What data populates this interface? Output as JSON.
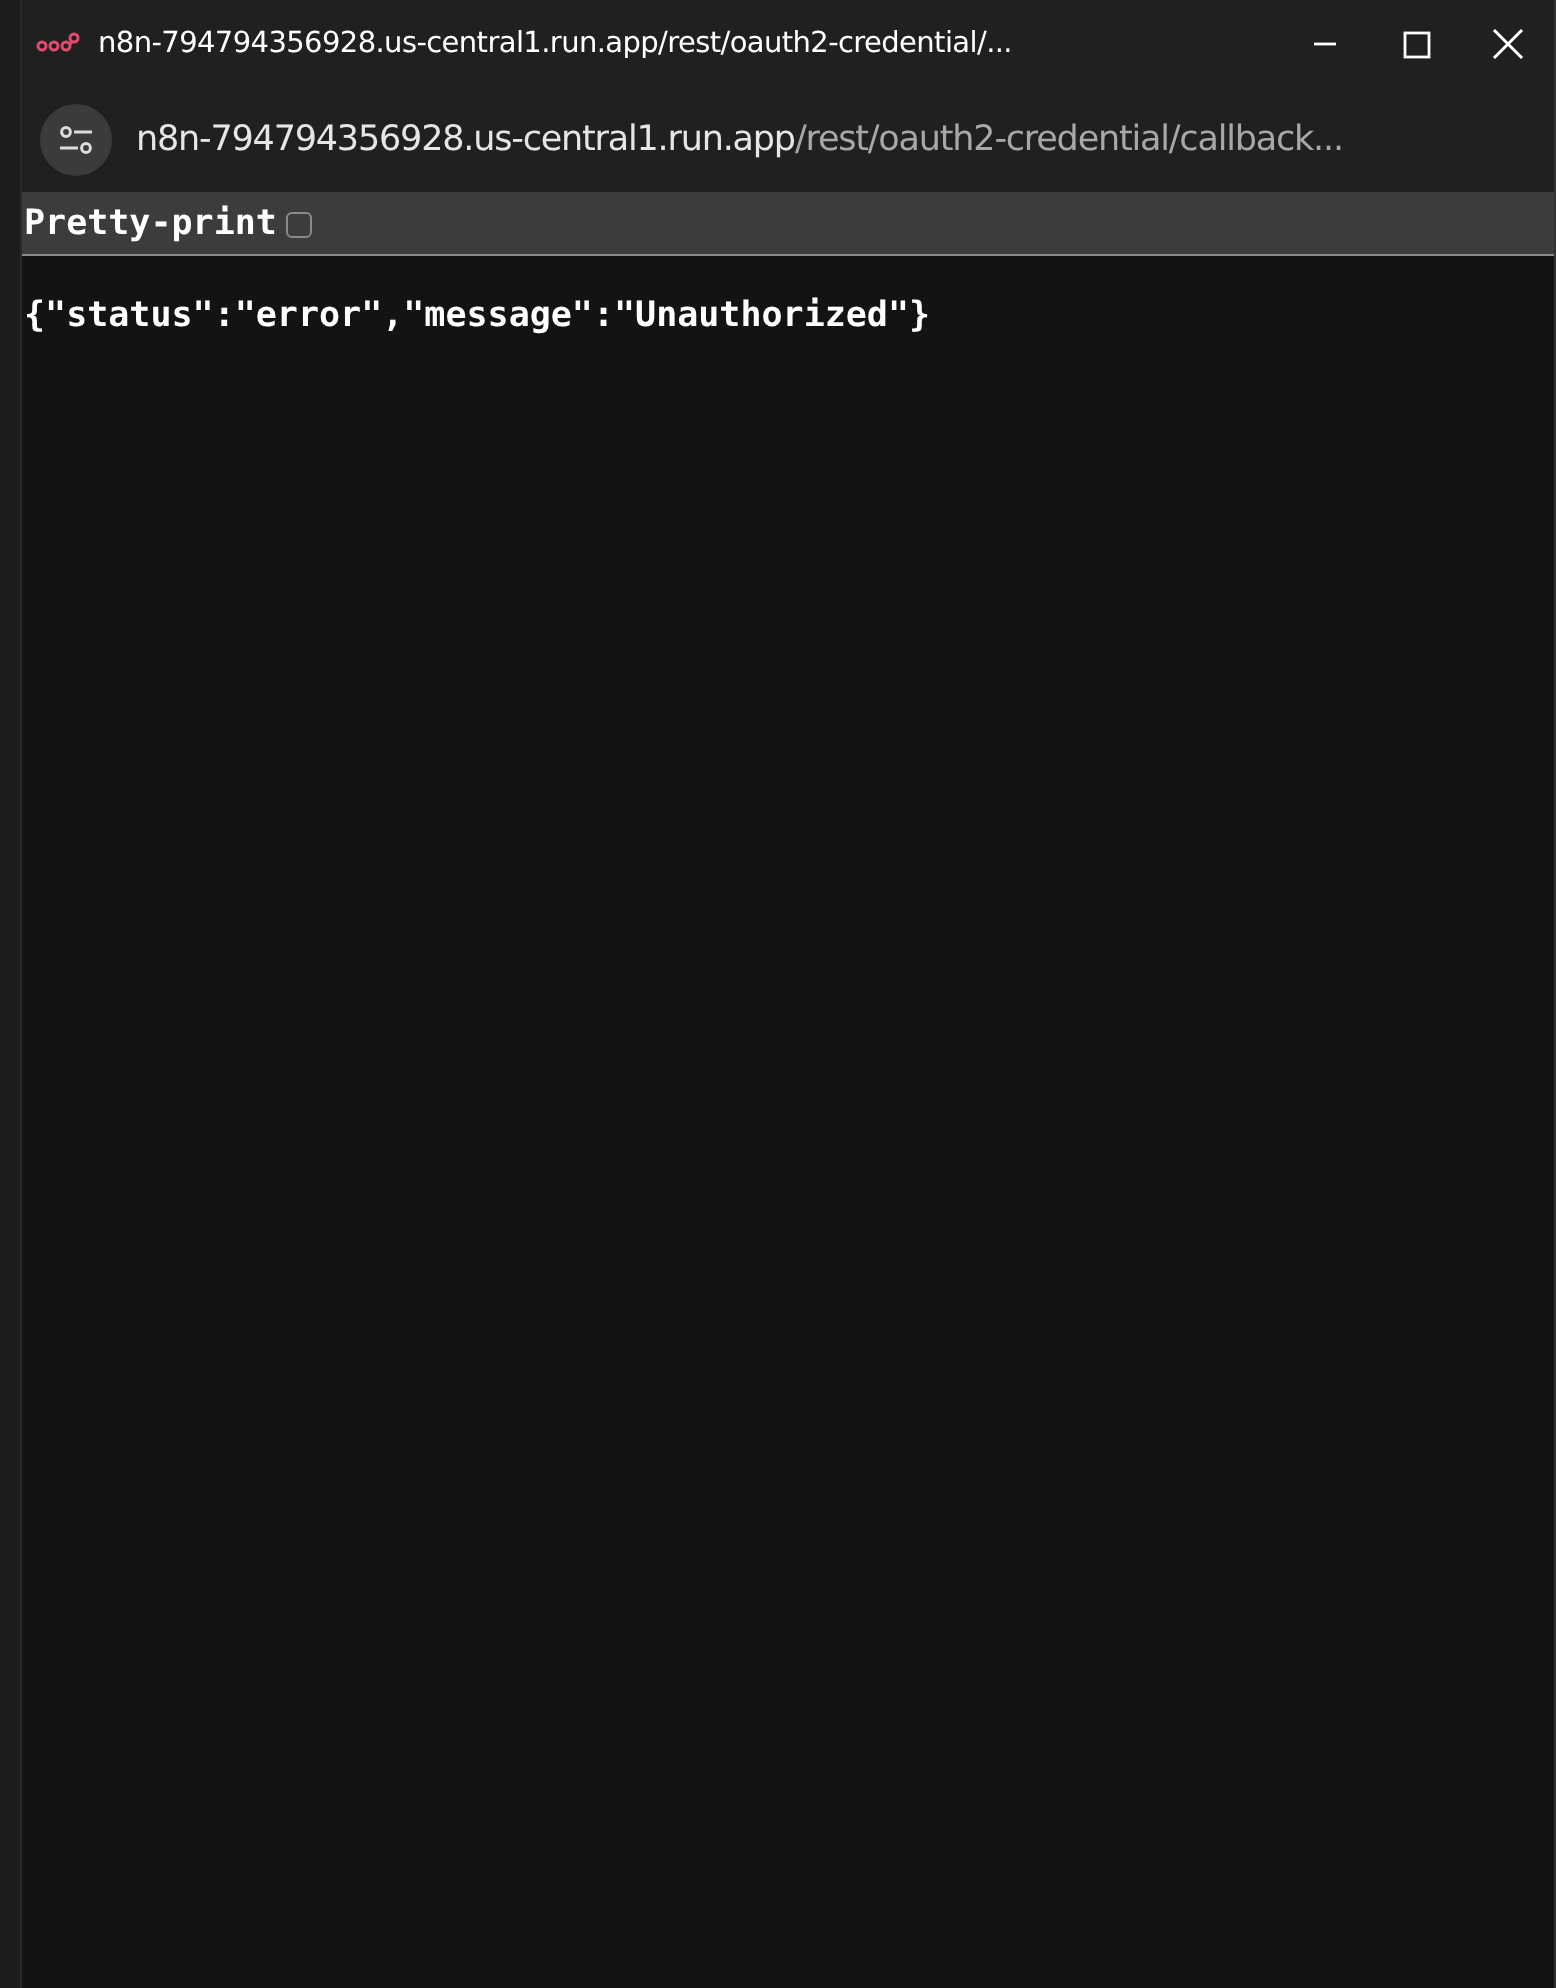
{
  "window": {
    "title": "n8n-794794356928.us-central1.run.app/rest/oauth2-credential/..."
  },
  "address_bar": {
    "host": "n8n-794794356928.us-central1.run.app",
    "path": "/rest/oauth2-credential/callback..."
  },
  "json_viewer": {
    "label": "Pretty-print",
    "checked": false,
    "content": "{\"status\":\"error\",\"message\":\"Unauthorized\"}"
  }
}
